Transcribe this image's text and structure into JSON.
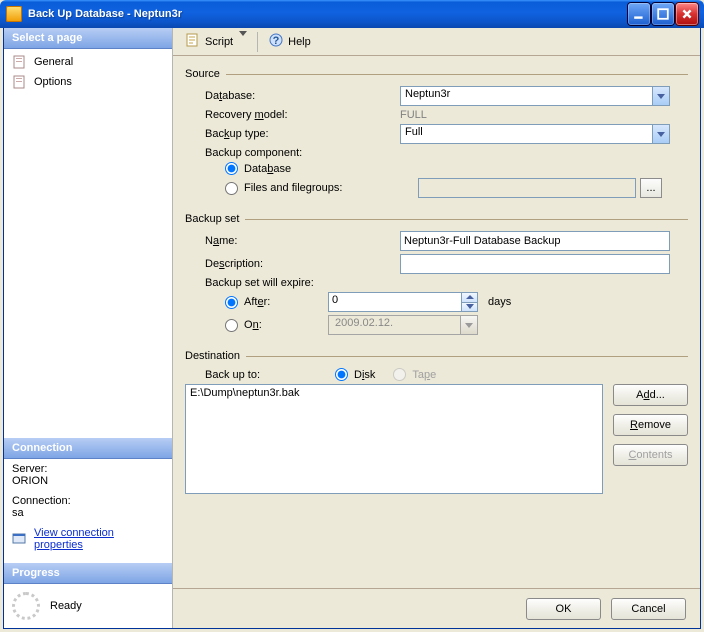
{
  "window": {
    "title": "Back Up Database - Neptun3r"
  },
  "sidebar": {
    "select_page": "Select a page",
    "pages": [
      {
        "label": "General"
      },
      {
        "label": "Options"
      }
    ],
    "connection_header": "Connection",
    "server_label": "Server:",
    "server_value": "ORION",
    "conn_label": "Connection:",
    "conn_value": "sa",
    "view_props": "View connection properties",
    "progress_header": "Progress",
    "progress_status": "Ready"
  },
  "toolbar": {
    "script": "Script",
    "help": "Help"
  },
  "source": {
    "legend": "Source",
    "database_label": "Database:",
    "database_value": "Neptun3r",
    "recovery_label": "Recovery model:",
    "recovery_value": "FULL",
    "backup_type_label": "Backup type:",
    "backup_type_value": "Full",
    "component_label": "Backup component:",
    "radio_db": "Database",
    "radio_fg": "Files and filegroups:",
    "ellipsis": "..."
  },
  "backupset": {
    "legend": "Backup set",
    "name_label": "Name:",
    "name_value": "Neptun3r-Full Database Backup",
    "desc_label": "Description:",
    "desc_value": "",
    "expire_label": "Backup set will expire:",
    "after": "After:",
    "after_value": "0",
    "days": "days",
    "on": "On:",
    "on_value": "2009.02.12."
  },
  "destination": {
    "legend": "Destination",
    "back_up_to": "Back up to:",
    "disk": "Disk",
    "tape": "Tape",
    "list": [
      "E:\\Dump\\neptun3r.bak"
    ],
    "add": "Add...",
    "remove": "Remove",
    "contents": "Contents"
  },
  "footer": {
    "ok": "OK",
    "cancel": "Cancel"
  }
}
